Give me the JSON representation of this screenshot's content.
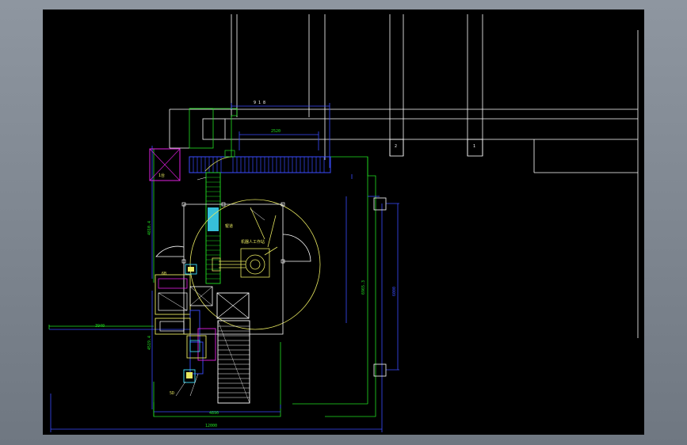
{
  "theme": {
    "viewport_bg": "#000000",
    "outer_bg": "#7f8791",
    "white": "#ffffff",
    "blue": "#3a4dff",
    "green": "#22e022",
    "yellow": "#e8e860",
    "magenta": "#e020e0",
    "cyan": "#40e0ff"
  },
  "dimensions": {
    "top_overall": "9 1 8",
    "inner_span": "2520",
    "left_run": "3940",
    "bottom_inner": "4890",
    "bottom_overall": "12000",
    "right_overall": "6965.3",
    "right_posts": "6000",
    "left_upper": "4810.4",
    "left_lower": "4519.4"
  },
  "axis_labels": {
    "grid_1": "1",
    "grid_2": "2"
  },
  "annotations": {
    "robot_station": "机器人工作站",
    "corner_box": "1台",
    "conveyor_tag": "辊道",
    "small_tag_1": "6B",
    "small_tag_2": "5D"
  }
}
